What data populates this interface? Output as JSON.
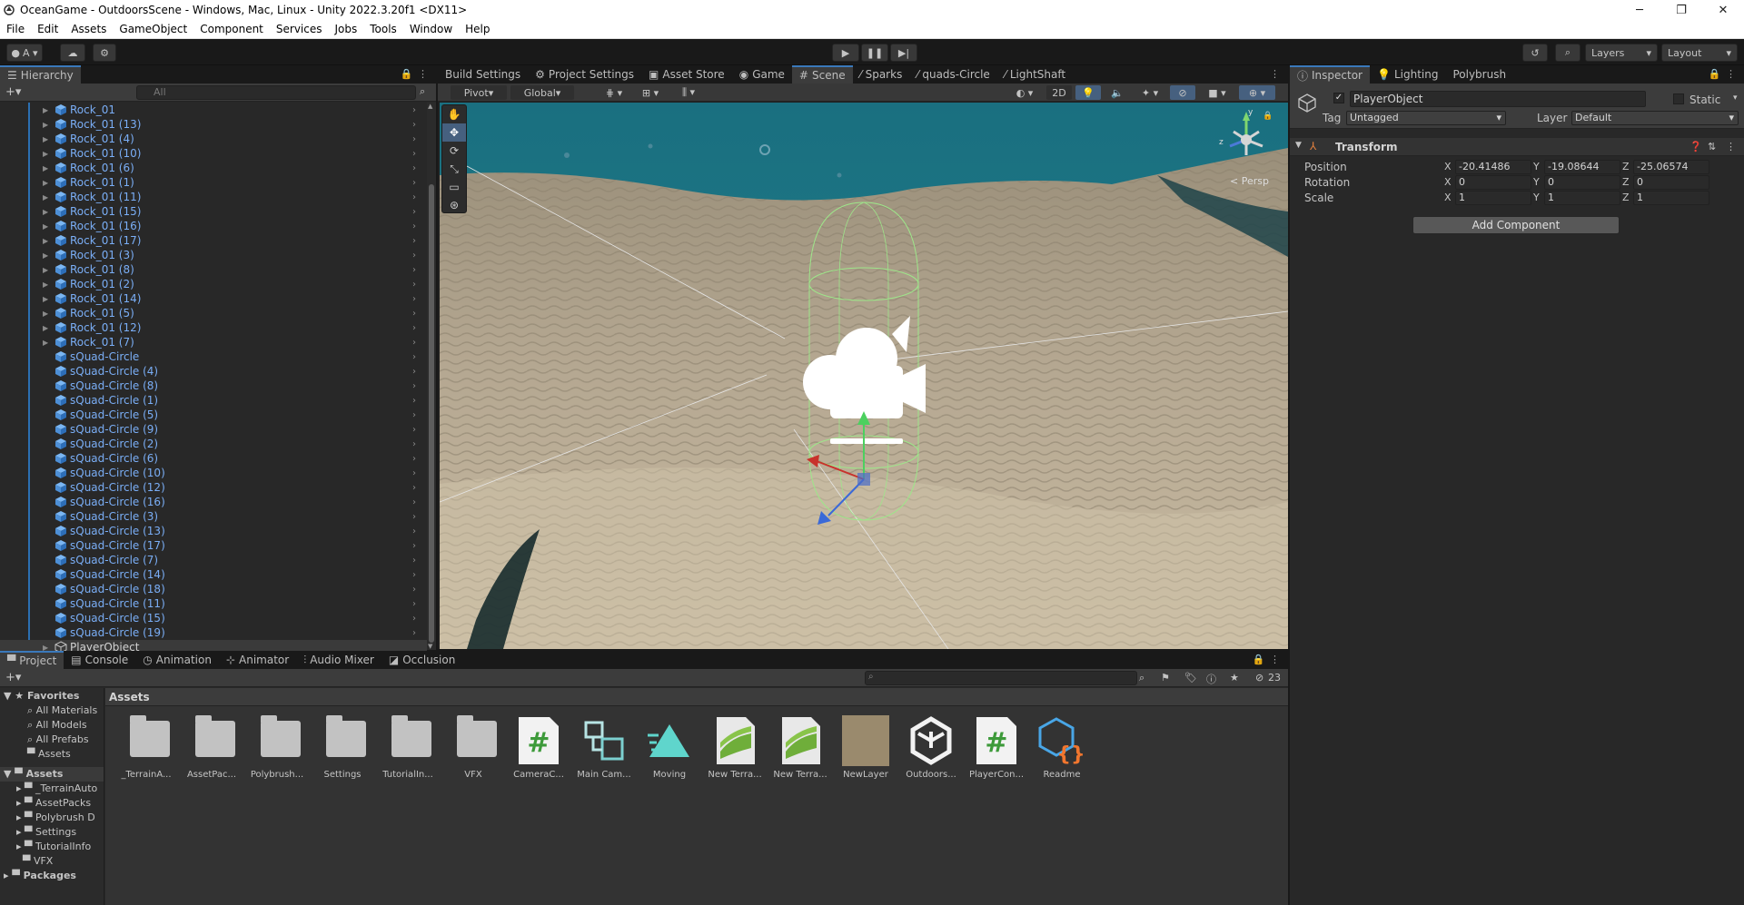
{
  "window": {
    "title": "OceanGame - OutdoorsScene - Windows, Mac, Linux - Unity 2022.3.20f1 <DX11>",
    "minimize": "─",
    "maximize": "❐",
    "close": "✕"
  },
  "menu": [
    "File",
    "Edit",
    "Assets",
    "GameObject",
    "Component",
    "Services",
    "Jobs",
    "Tools",
    "Window",
    "Help"
  ],
  "toolbar": {
    "account": "A ▾",
    "layers": "Layers",
    "layout": "Layout"
  },
  "hierarchy": {
    "title": "Hierarchy",
    "search_placeholder": "All",
    "items": [
      {
        "label": "Rock_01",
        "fold": true
      },
      {
        "label": "Rock_01 (13)",
        "fold": true
      },
      {
        "label": "Rock_01 (4)",
        "fold": true
      },
      {
        "label": "Rock_01 (10)",
        "fold": true
      },
      {
        "label": "Rock_01 (6)",
        "fold": true
      },
      {
        "label": "Rock_01 (1)",
        "fold": true
      },
      {
        "label": "Rock_01 (11)",
        "fold": true
      },
      {
        "label": "Rock_01 (15)",
        "fold": true
      },
      {
        "label": "Rock_01 (16)",
        "fold": true
      },
      {
        "label": "Rock_01 (17)",
        "fold": true
      },
      {
        "label": "Rock_01 (3)",
        "fold": true
      },
      {
        "label": "Rock_01 (8)",
        "fold": true
      },
      {
        "label": "Rock_01 (2)",
        "fold": true
      },
      {
        "label": "Rock_01 (14)",
        "fold": true
      },
      {
        "label": "Rock_01 (5)",
        "fold": true
      },
      {
        "label": "Rock_01 (12)",
        "fold": true
      },
      {
        "label": "Rock_01 (7)",
        "fold": true
      },
      {
        "label": "sQuad-Circle",
        "fold": false
      },
      {
        "label": "sQuad-Circle (4)",
        "fold": false
      },
      {
        "label": "sQuad-Circle (8)",
        "fold": false
      },
      {
        "label": "sQuad-Circle (1)",
        "fold": false
      },
      {
        "label": "sQuad-Circle (5)",
        "fold": false
      },
      {
        "label": "sQuad-Circle (9)",
        "fold": false
      },
      {
        "label": "sQuad-Circle (2)",
        "fold": false
      },
      {
        "label": "sQuad-Circle (6)",
        "fold": false
      },
      {
        "label": "sQuad-Circle (10)",
        "fold": false
      },
      {
        "label": "sQuad-Circle (12)",
        "fold": false
      },
      {
        "label": "sQuad-Circle (16)",
        "fold": false
      },
      {
        "label": "sQuad-Circle (3)",
        "fold": false
      },
      {
        "label": "sQuad-Circle (13)",
        "fold": false
      },
      {
        "label": "sQuad-Circle (17)",
        "fold": false
      },
      {
        "label": "sQuad-Circle (7)",
        "fold": false
      },
      {
        "label": "sQuad-Circle (14)",
        "fold": false
      },
      {
        "label": "sQuad-Circle (18)",
        "fold": false
      },
      {
        "label": "sQuad-Circle (11)",
        "fold": false
      },
      {
        "label": "sQuad-Circle (15)",
        "fold": false
      },
      {
        "label": "sQuad-Circle (19)",
        "fold": false
      },
      {
        "label": "PlayerObject",
        "fold": true,
        "selected": true
      }
    ]
  },
  "scene_tabs": [
    "Build Settings",
    "Project Settings",
    "Asset Store",
    "Game",
    "Scene",
    "Sparks",
    "quads-Circle",
    "LightShaft"
  ],
  "scene": {
    "pivot": "Pivot",
    "global": "Global",
    "mode_2d": "2D",
    "persp": "< Persp",
    "gizmo_y": "y",
    "gizmo_z": "z"
  },
  "inspector": {
    "tabs": [
      "Inspector",
      "Lighting",
      "Polybrush"
    ],
    "object_name": "PlayerObject",
    "static_label": "Static",
    "tag_label": "Tag",
    "tag_value": "Untagged",
    "layer_label": "Layer",
    "layer_value": "Default",
    "component": "Transform",
    "rows": [
      {
        "label": "Position",
        "x": "-20.41486",
        "y": "-19.08644",
        "z": "-25.06574"
      },
      {
        "label": "Rotation",
        "x": "0",
        "y": "0",
        "z": "0"
      },
      {
        "label": "Scale",
        "x": "1",
        "y": "1",
        "z": "1"
      }
    ],
    "axis_x": "X",
    "axis_y": "Y",
    "axis_z": "Z",
    "add_component": "Add Component"
  },
  "bottom_tabs": [
    "Project",
    "Console",
    "Animation",
    "Animator",
    "Audio Mixer",
    "Occlusion"
  ],
  "project": {
    "hidden_count": "23",
    "breadcrumb": "Assets",
    "favorites_title": "Favorites",
    "favorites": [
      "All Materials",
      "All Models",
      "All Prefabs",
      "Assets"
    ],
    "assets_title": "Assets",
    "assets_tree": [
      "_TerrainAuto",
      "AssetPacks",
      "Polybrush D",
      "Settings",
      "TutorialInfo",
      "VFX"
    ],
    "packages_title": "Packages",
    "assets": [
      {
        "label": "_TerrainA...",
        "kind": "folder"
      },
      {
        "label": "AssetPac...",
        "kind": "folder"
      },
      {
        "label": "Polybrush...",
        "kind": "folder"
      },
      {
        "label": "Settings",
        "kind": "folder"
      },
      {
        "label": "TutorialIn...",
        "kind": "folder"
      },
      {
        "label": "VFX",
        "kind": "folder"
      },
      {
        "label": "CameraC...",
        "kind": "script"
      },
      {
        "label": "Main Cam...",
        "kind": "prefab"
      },
      {
        "label": "Moving",
        "kind": "anim"
      },
      {
        "label": "New Terra...",
        "kind": "terrain"
      },
      {
        "label": "New Terra...",
        "kind": "terrain"
      },
      {
        "label": "NewLayer",
        "kind": "layer"
      },
      {
        "label": "Outdoors...",
        "kind": "unity"
      },
      {
        "label": "PlayerCon...",
        "kind": "script"
      },
      {
        "label": "Readme",
        "kind": "readme"
      }
    ]
  }
}
